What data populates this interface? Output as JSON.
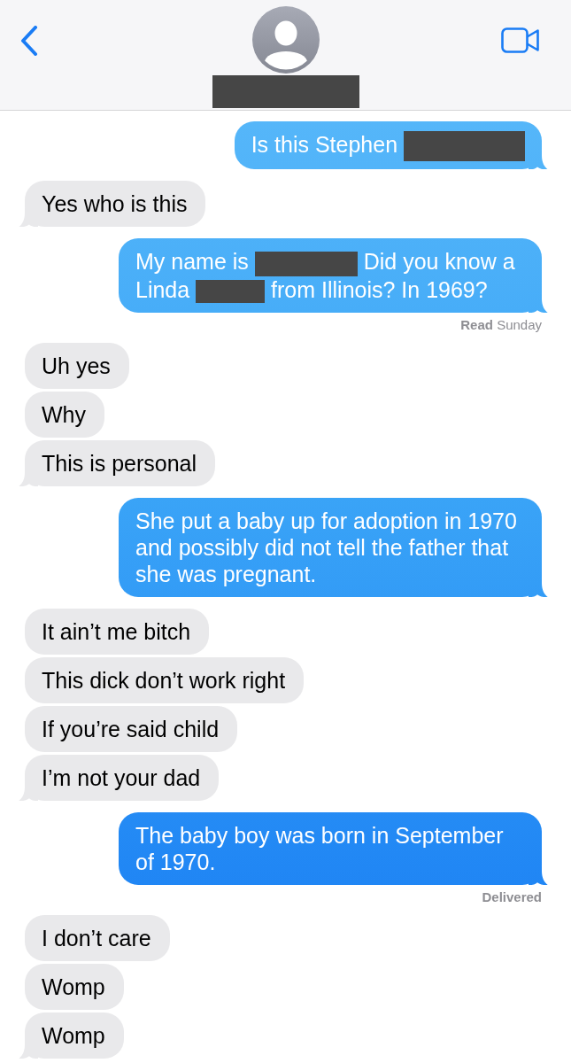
{
  "header": {
    "contact": {
      "name": {
        "kind": "redaction"
      }
    }
  },
  "messages": [
    {
      "kind": "sent",
      "tail": true,
      "parts": [
        {
          "kind": "text",
          "text": "Is this Stephen"
        },
        {
          "kind": "redaction"
        }
      ]
    },
    {
      "kind": "received",
      "tail": true,
      "parts": [
        {
          "kind": "text",
          "text": "Yes who is this"
        }
      ]
    },
    {
      "kind": "sent",
      "tail": true,
      "parts": [
        {
          "kind": "text",
          "text": "My name is"
        },
        {
          "kind": "redaction"
        },
        {
          "kind": "text",
          "text": "Did you know a"
        },
        {
          "kind": "text",
          "text": "Linda"
        },
        {
          "kind": "redaction"
        },
        {
          "kind": "text",
          "text": "from Illinois? In 1969?"
        }
      ]
    },
    {
      "kind": "status",
      "state": "Read",
      "time": "Sunday"
    },
    {
      "kind": "received",
      "tail": false,
      "parts": [
        {
          "kind": "text",
          "text": "Uh yes"
        }
      ]
    },
    {
      "kind": "received",
      "tail": false,
      "parts": [
        {
          "kind": "text",
          "text": "Why"
        }
      ]
    },
    {
      "kind": "received",
      "tail": true,
      "parts": [
        {
          "kind": "text",
          "text": "This is personal"
        }
      ]
    },
    {
      "kind": "sent",
      "tail": true,
      "parts": [
        {
          "kind": "text",
          "text": "She put a baby up for adoption in 1970 and possibly did not tell the father that she was pregnant."
        }
      ]
    },
    {
      "kind": "received",
      "tail": false,
      "parts": [
        {
          "kind": "text",
          "text": "It ain’t me bitch"
        }
      ]
    },
    {
      "kind": "received",
      "tail": false,
      "parts": [
        {
          "kind": "text",
          "text": "This dick don’t work right"
        }
      ]
    },
    {
      "kind": "received",
      "tail": false,
      "parts": [
        {
          "kind": "text",
          "text": "If you’re said child"
        }
      ]
    },
    {
      "kind": "received",
      "tail": true,
      "parts": [
        {
          "kind": "text",
          "text": "I’m not your dad"
        }
      ]
    },
    {
      "kind": "sent",
      "tail": true,
      "parts": [
        {
          "kind": "text",
          "text": "The baby boy was born in September of 1970."
        }
      ]
    },
    {
      "kind": "status",
      "state": "Delivered"
    },
    {
      "kind": "received",
      "tail": false,
      "parts": [
        {
          "kind": "text",
          "text": "I don’t care"
        }
      ]
    },
    {
      "kind": "received",
      "tail": false,
      "parts": [
        {
          "kind": "text",
          "text": "Womp"
        }
      ]
    },
    {
      "kind": "received",
      "tail": true,
      "parts": [
        {
          "kind": "text",
          "text": "Womp"
        }
      ]
    }
  ]
}
